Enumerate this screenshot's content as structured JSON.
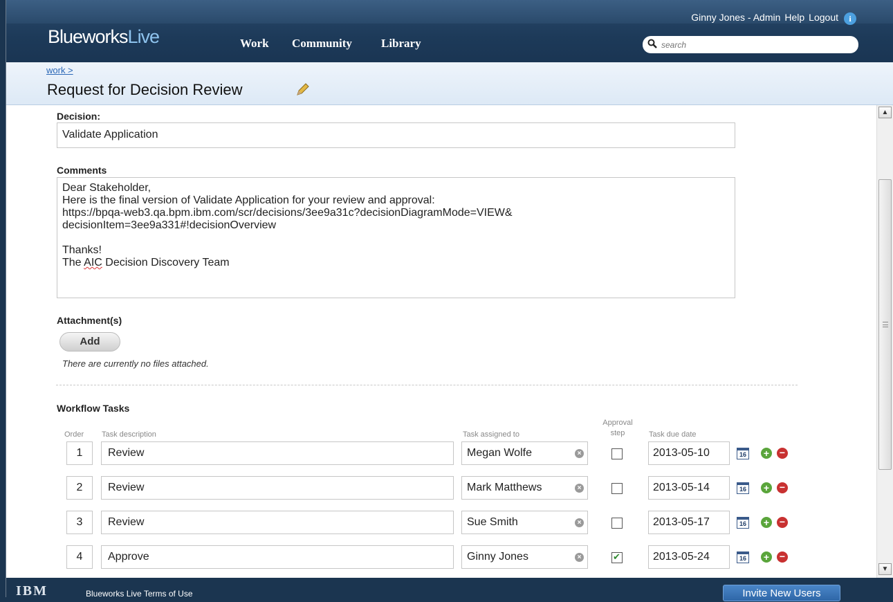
{
  "header": {
    "logo_main": "Blueworks",
    "logo_accent": "Live",
    "nav": [
      "Work",
      "Community",
      "Library"
    ],
    "user": "Ginny Jones - Admin",
    "help": "Help",
    "logout": "Logout",
    "info_icon": "i",
    "search_placeholder": "search"
  },
  "breadcrumb": "work >",
  "page_title": "Request for Decision Review",
  "decision": {
    "label": "Decision:",
    "value": "Validate Application"
  },
  "comments": {
    "label": "Comments",
    "line1": "Dear Stakeholder,",
    "line2": "Here is the final version of Validate Application for your review and approval:",
    "line3": "https://bpqa-web3.qa.bpm.ibm.com/scr/decisions/3ee9a31c?decisionDiagramMode=VIEW&",
    "line4": "decisionItem=3ee9a331#!decisionOverview",
    "line5": "Thanks!",
    "line6_prefix": "The ",
    "line6_misspelled": "AIC",
    "line6_suffix": " Decision Discovery Team"
  },
  "attachments": {
    "label": "Attachment(s)",
    "add_button": "Add",
    "empty_text": "There are currently no files attached."
  },
  "workflow": {
    "label": "Workflow Tasks",
    "headers": {
      "order": "Order",
      "description": "Task description",
      "assigned": "Task assigned to",
      "approval_line1": "Approval",
      "approval_line2": "step",
      "due": "Task due date"
    },
    "rows": [
      {
        "order": "1",
        "description": "Review",
        "assignee": "Megan Wolfe",
        "approval": false,
        "due": "2013-05-10"
      },
      {
        "order": "2",
        "description": "Review",
        "assignee": "Mark Matthews",
        "approval": false,
        "due": "2013-05-14"
      },
      {
        "order": "3",
        "description": "Review",
        "assignee": "Sue Smith",
        "approval": false,
        "due": "2013-05-17"
      },
      {
        "order": "4",
        "description": "Approve",
        "assignee": "Ginny Jones",
        "approval": true,
        "due": "2013-05-24"
      }
    ],
    "calendar_day": "16"
  },
  "footer": {
    "brand": "IBM",
    "links": "Blueworks Live  Terms of Use",
    "invite_button": "Invite New Users"
  },
  "colors": {
    "header_bg": "#1d3a59",
    "link": "#2a67b6",
    "add_green": "#5aa53b",
    "remove_red": "#c83131"
  }
}
